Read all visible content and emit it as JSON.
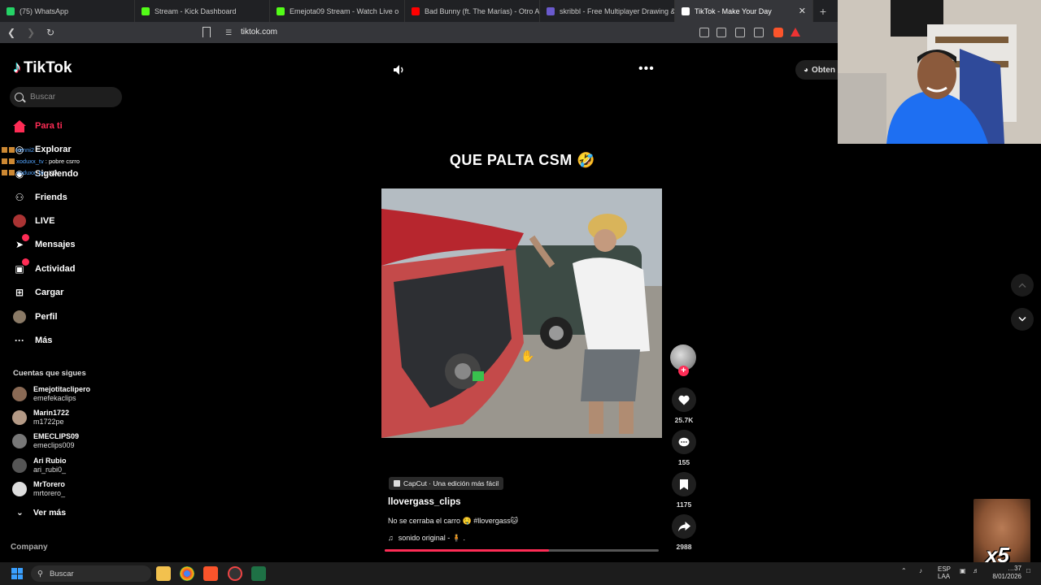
{
  "browser": {
    "tabs": [
      {
        "title": "(75) WhatsApp",
        "color": "#25d366"
      },
      {
        "title": "Stream - Kick Dashboard",
        "color": "#53fc18"
      },
      {
        "title": "Emejota09 Stream - Watch Live o",
        "color": "#53fc18"
      },
      {
        "title": "Bad Bunny (ft. The Marías) - Otro Ata",
        "color": "#ff0000"
      },
      {
        "title": "skribbl - Free Multiplayer Drawing &",
        "color": "#6a5acd"
      },
      {
        "title": "TikTok - Make Your Day",
        "color": "#ffffff",
        "active": true
      }
    ],
    "new_tab": "+",
    "close": "✕",
    "url": "tiktok.com"
  },
  "tiktok": {
    "logo": "TikTok",
    "search_placeholder": "Buscar",
    "nav": [
      {
        "label": "Para ti",
        "icon": "home-icon",
        "glyph": "⌂"
      },
      {
        "label": "Explorar",
        "icon": "compass-icon",
        "glyph": "◎"
      },
      {
        "label": "Siguiendo",
        "icon": "following-icon",
        "glyph": "◉"
      },
      {
        "label": "Friends",
        "icon": "friends-icon",
        "glyph": "⚇"
      },
      {
        "label": "LIVE",
        "icon": "live-icon",
        "glyph": "●"
      },
      {
        "label": "Mensajes",
        "icon": "send-icon",
        "glyph": "➤"
      },
      {
        "label": "Actividad",
        "icon": "inbox-icon",
        "glyph": "▣"
      },
      {
        "label": "Cargar",
        "icon": "upload-icon",
        "glyph": "⊞"
      },
      {
        "label": "Perfil",
        "icon": "avatar-icon",
        "glyph": "●"
      },
      {
        "label": "Más",
        "icon": "more-icon",
        "glyph": "···"
      }
    ],
    "chat": [
      {
        "user": "kenni2",
        "text": ""
      },
      {
        "user": "xoduxx_tv",
        "text": ": pobre csrro"
      },
      {
        "user": "xoduxx_tv",
        "text": ": XD"
      }
    ],
    "following_title": "Cuentas que sigues",
    "following": [
      {
        "name": "Emejotitaclipero",
        "handle": "emefekaclips",
        "color": "#8a6a55"
      },
      {
        "name": "Marin1722",
        "handle": "m1722pe",
        "color": "#b49a86"
      },
      {
        "name": "EMECLIPS09",
        "handle": "emeclips009",
        "color": "#777777"
      },
      {
        "name": "Ari Rubio",
        "handle": "ari_rubi0_",
        "color": "#555555"
      },
      {
        "name": "MrTorero",
        "handle": "mrtorero_",
        "color": "#dddddd"
      }
    ],
    "see_more": "Ver más",
    "company": "Company",
    "get_app": "Obten"
  },
  "video": {
    "overlay_text": "QUE PALTA CSM 🤣",
    "capcut": "CapCut · Una edición más fácil",
    "author": "llovergass_clips",
    "description": "No se cerraba el carro 🤤 #llovergass🐱",
    "sound": "sonido original - 🧍 .",
    "progress": 0.6,
    "likes": "25.7K",
    "comments": "155",
    "saves": "1175",
    "shares": "2988",
    "plus": "+"
  },
  "overlay": {
    "multiplier": "x5"
  },
  "taskbar": {
    "search": "Buscar",
    "lang_top": "ESP",
    "lang_bottom": "LAA",
    "time": "…37",
    "date": "8/01/2026"
  }
}
